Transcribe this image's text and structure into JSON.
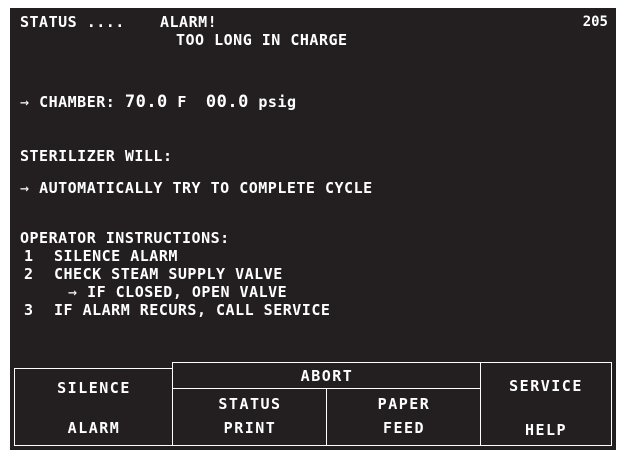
{
  "screen": {
    "status_label": "STATUS ....",
    "alarm_title": "ALARM!",
    "alarm_detail": "TOO LONG IN CHARGE",
    "screen_number": "205",
    "arrow_glyph": "→",
    "chamber": {
      "label": "CHAMBER:",
      "temperature": "70.0",
      "temperature_unit": "F",
      "pressure": "00.0",
      "pressure_unit": "psig"
    },
    "sterilizer_will": {
      "heading": "STERILIZER WILL:",
      "action": "AUTOMATICALLY TRY TO COMPLETE CYCLE"
    },
    "operator_instructions": {
      "heading": "OPERATOR INSTRUCTIONS:",
      "steps": [
        {
          "number": "1",
          "text": "SILENCE ALARM"
        },
        {
          "number": "2",
          "text": "CHECK STEAM SUPPLY VALVE",
          "sub": "IF CLOSED, OPEN VALVE"
        },
        {
          "number": "3",
          "text": "IF ALARM RECURS, CALL SERVICE"
        }
      ]
    }
  },
  "softkeys": {
    "silence_alarm": {
      "line1": "SILENCE",
      "line2": "ALARM"
    },
    "abort": {
      "label": "ABORT"
    },
    "status_print": {
      "line1": "STATUS",
      "line2": "PRINT"
    },
    "paper_feed": {
      "line1": "PAPER",
      "line2": "FEED"
    },
    "service_help": {
      "line1": "SERVICE",
      "line2": "HELP"
    }
  },
  "colors": {
    "background": "#231f20",
    "text": "#ffffff"
  }
}
